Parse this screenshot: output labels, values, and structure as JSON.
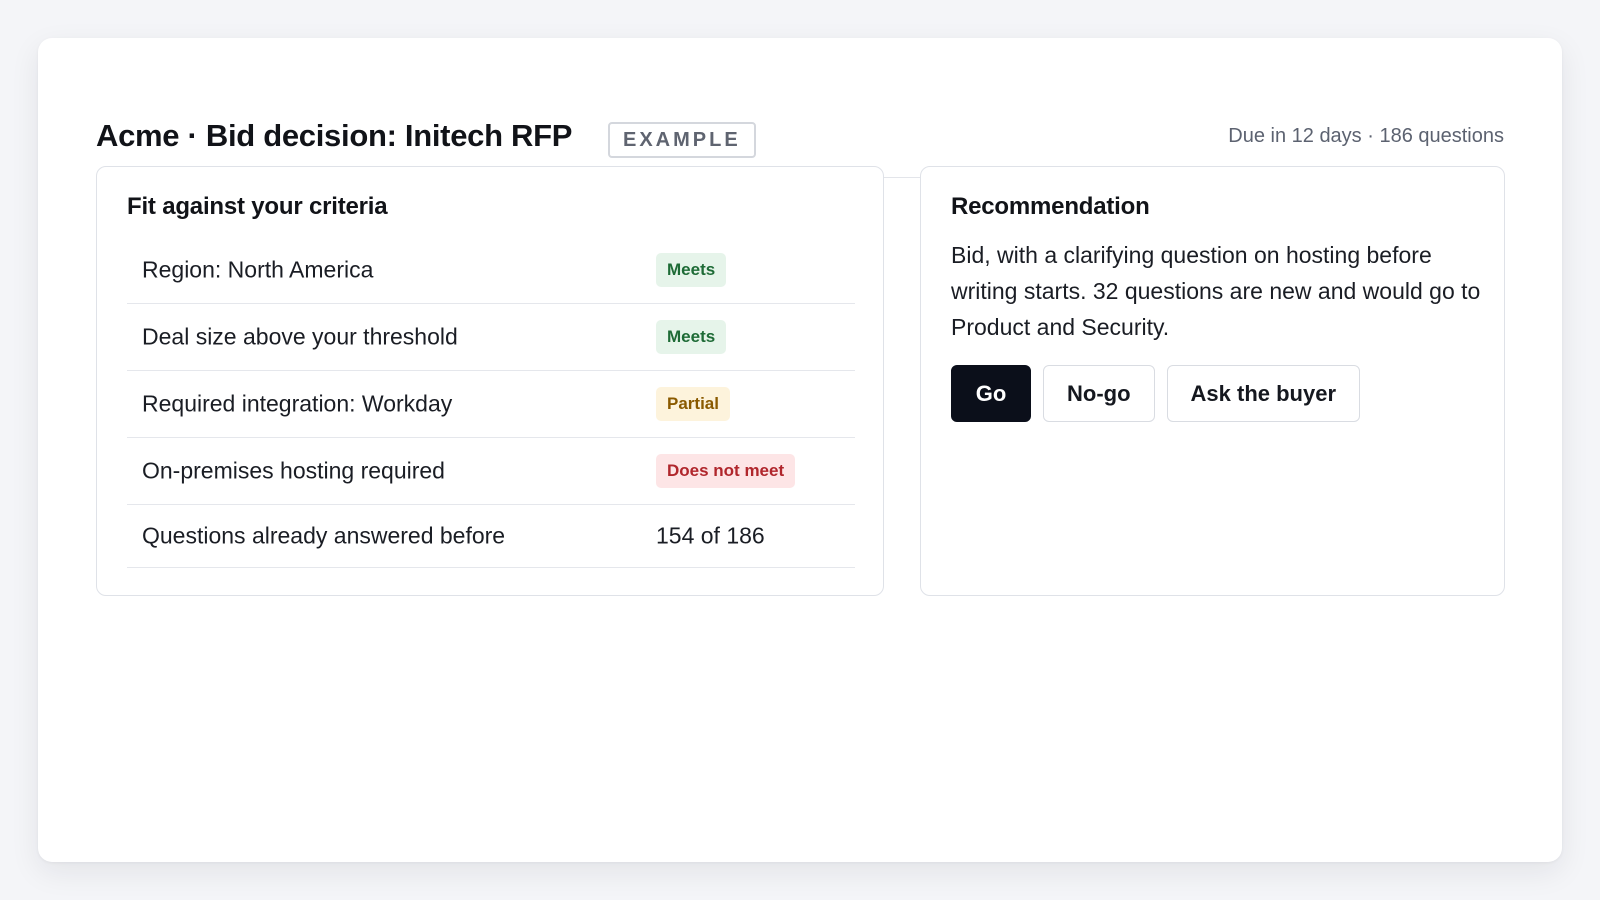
{
  "header": {
    "title": "Acme · Bid decision: Initech RFP",
    "tag": "EXAMPLE",
    "meta": "Due in 12 days · 186 questions"
  },
  "criteria_panel": {
    "title": "Fit against your criteria",
    "rows": [
      {
        "label": "Region: North America",
        "status": "Meets",
        "status_kind": "meets"
      },
      {
        "label": "Deal size above your threshold",
        "status": "Meets",
        "status_kind": "meets"
      },
      {
        "label": "Required integration: Workday",
        "status": "Partial",
        "status_kind": "partial"
      },
      {
        "label": "On-premises hosting required",
        "status": "Does not meet",
        "status_kind": "fail"
      },
      {
        "label": "Questions already answered before",
        "value": "154 of 186"
      }
    ]
  },
  "recommendation_panel": {
    "title": "Recommendation",
    "text": "Bid, with a clarifying question on hosting before writing starts. 32 questions are new and would go to Product and Security.",
    "buttons": {
      "go": "Go",
      "no_go": "No-go",
      "ask": "Ask the buyer"
    }
  },
  "colors": {
    "meets_bg": "#e6f4ea",
    "meets_fg": "#1e6b36",
    "partial_bg": "#fdf3dc",
    "partial_fg": "#8a5a00",
    "fail_bg": "#fde5e6",
    "fail_fg": "#b0262c",
    "primary": "#0b0f1a"
  }
}
